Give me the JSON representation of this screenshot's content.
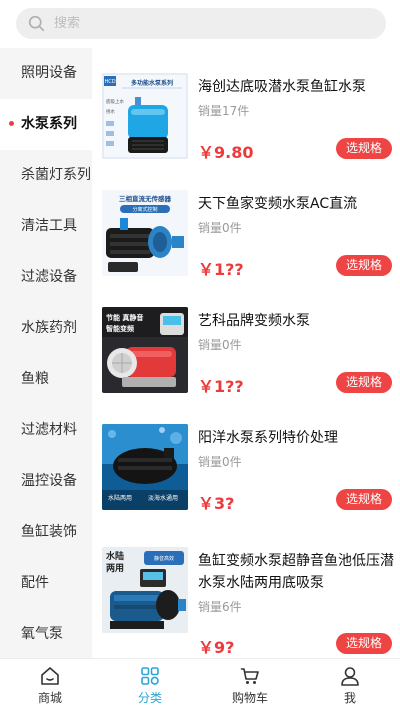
{
  "search": {
    "placeholder": "搜索"
  },
  "sidebar": {
    "items": [
      {
        "label": "照明设备"
      },
      {
        "label": "水泵系列",
        "active": true
      },
      {
        "label": "杀菌灯系列"
      },
      {
        "label": "清洁工具"
      },
      {
        "label": "过滤设备"
      },
      {
        "label": "水族药剂"
      },
      {
        "label": "鱼粮"
      },
      {
        "label": "过滤材料"
      },
      {
        "label": "温控设备"
      },
      {
        "label": "鱼缸装饰"
      },
      {
        "label": "配件"
      },
      {
        "label": "氧气泵"
      }
    ]
  },
  "products": [
    {
      "name": "海创达底吸潜水泵鱼缸水泵",
      "sold": "销量17件",
      "price": "￥9.80",
      "button": "选规格",
      "image_text": [
        "多功能水泵系列"
      ],
      "image_side_text": [
        "底吸上水",
        "拐水"
      ],
      "brand": "HCD"
    },
    {
      "name": "天下鱼家变频水泵AC直流",
      "sold": "销量0件",
      "price": "￥1??",
      "button": "选规格",
      "image_text": [
        "三相直流无传感器",
        "分离式控制"
      ]
    },
    {
      "name": "艺科品牌变频水泵",
      "sold": "销量0件",
      "price": "￥1??",
      "button": "选规格",
      "image_text": [
        "节能 真静音",
        "智能变频"
      ]
    },
    {
      "name": "阳洋水泵系列特价处理",
      "sold": "销量0件",
      "price": "￥3?",
      "button": "选规格",
      "image_text": [
        "水陆两用",
        "淡海水通用"
      ]
    },
    {
      "name": "鱼缸变频水泵超静音鱼池低压潜水泵水陆两用底吸泵",
      "sold": "销量6件",
      "price": "￥9?",
      "button": "选规格",
      "image_text": [
        "水陆",
        "两用"
      ],
      "image_badge": "静音高效"
    }
  ],
  "tabbar": {
    "tabs": [
      {
        "label": "商城",
        "icon": "home-icon"
      },
      {
        "label": "分类",
        "icon": "category-icon",
        "active": true
      },
      {
        "label": "购物车",
        "icon": "cart-icon"
      },
      {
        "label": "我",
        "icon": "user-icon"
      }
    ]
  },
  "colors": {
    "accent": "#2ba5d8",
    "price": "#ee3a3a",
    "button": "#ef4444",
    "active_dot": "#e94046",
    "sidebar_bg": "#f5f5f5"
  }
}
